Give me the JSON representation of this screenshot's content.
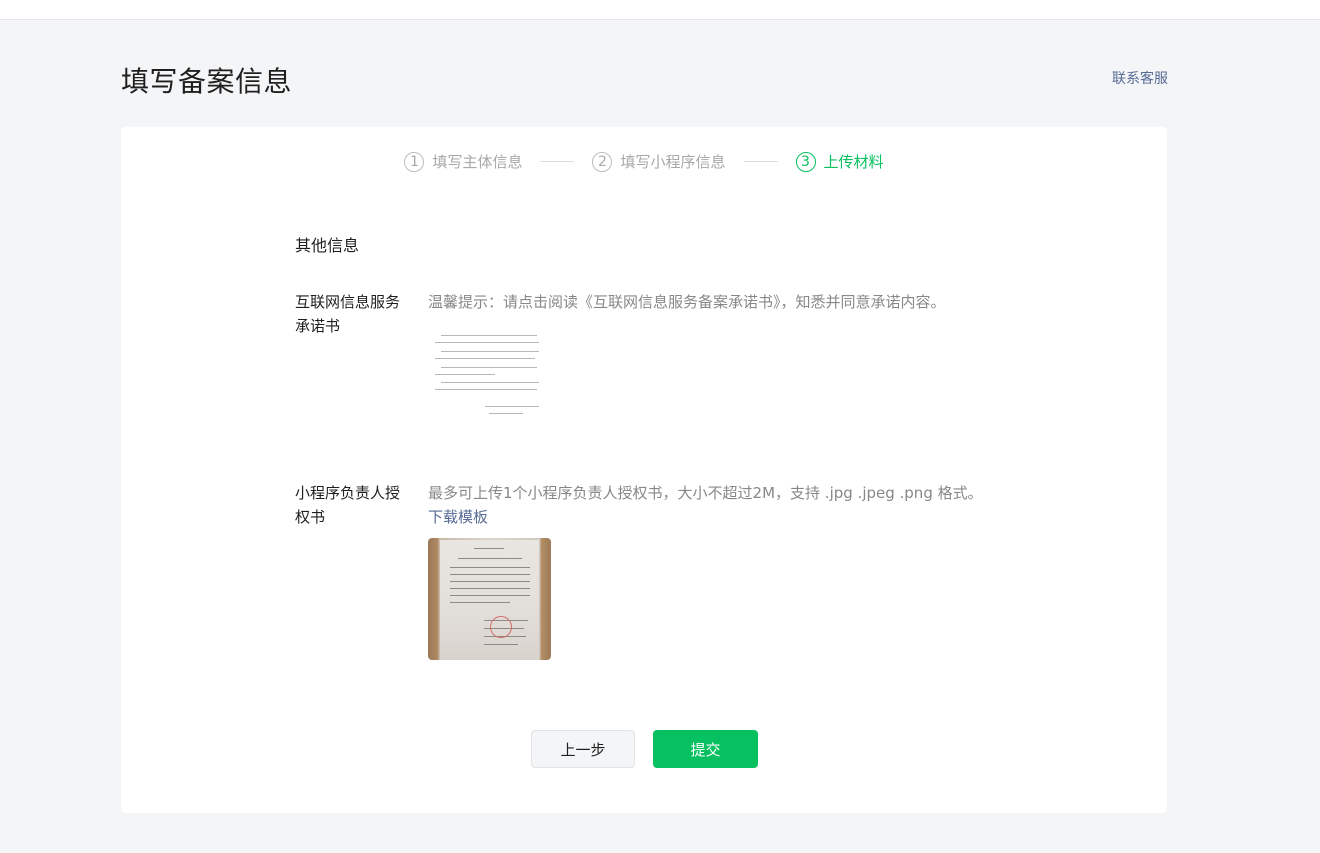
{
  "header": {
    "title": "填写备案信息",
    "contact_link": "联系客服"
  },
  "steps": [
    {
      "num": "1",
      "label": "填写主体信息",
      "state": "done"
    },
    {
      "num": "2",
      "label": "填写小程序信息",
      "state": "done"
    },
    {
      "num": "3",
      "label": "上传材料",
      "state": "active"
    }
  ],
  "colors": {
    "accent": "#07c160",
    "link": "#576b95",
    "background": "#f4f5f7"
  },
  "form": {
    "section_title": "其他信息",
    "commitment": {
      "label": "互联网信息服务承诺书",
      "hint": "温馨提示：请点击阅读《互联网信息服务备案承诺书》，知悉并同意承诺内容。",
      "thumbnail_icon": "document-thumbnail-icon"
    },
    "authorization": {
      "label": "小程序负责人授权书",
      "hint": "最多可上传1个小程序负责人授权书，大小不超过2M，支持 .jpg .jpeg .png 格式。",
      "download_link": "下载模板",
      "thumbnail_icon": "uploaded-photo-thumbnail-icon"
    }
  },
  "actions": {
    "prev_label": "上一步",
    "submit_label": "提交"
  }
}
